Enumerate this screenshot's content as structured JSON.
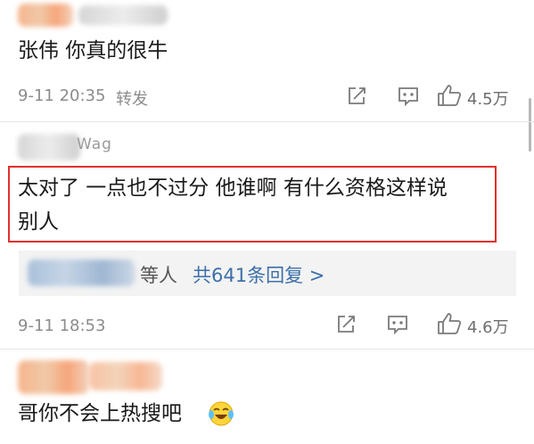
{
  "comments": [
    {
      "text": "张伟 你真的很牛",
      "time": "9-11 20:35",
      "repost_label": "转发",
      "likes": "4.5万",
      "icons": [
        "repost-icon",
        "comment-icon",
        "like-icon"
      ]
    },
    {
      "username_fragment": "Wag",
      "text_line1": "太对了 一点也不过分 他谁啊 有什么资格这样说",
      "text_line2": "别人",
      "reply_who": "等人",
      "reply_link": "共641条回复 >",
      "time": "9-11 18:53",
      "likes": "4.6万",
      "icons": [
        "repost-icon",
        "comment-icon",
        "like-icon"
      ]
    },
    {
      "text": "哥你不会上热搜吧",
      "emoji": "laughing-crying-emoji"
    }
  ],
  "colors": {
    "highlight_border": "#e2302b",
    "link": "#3c6faa",
    "meta": "#8c8c8c"
  }
}
